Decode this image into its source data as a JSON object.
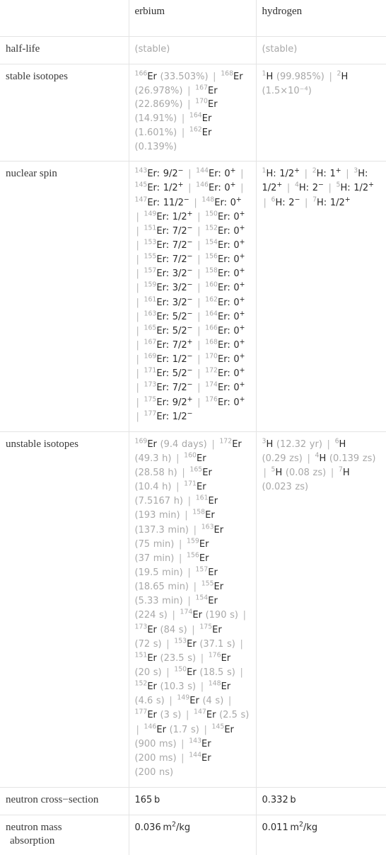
{
  "table": {
    "columns": [
      "",
      "erbium",
      "hydrogen"
    ],
    "rows": [
      {
        "label": "half-life",
        "erbium": "(stable)",
        "hydrogen": "(stable)"
      },
      {
        "label": "stable isotopes",
        "erbium": "166Er (33.503%) | 168Er (26.978%) | 167Er (22.869%) | 170Er (14.91%) | 164Er (1.601%) | 162Er (0.139%)",
        "hydrogen": "1H (99.985%) | 2H (1.5×10^-4)"
      },
      {
        "label": "nuclear spin",
        "erbium": "143Er: 9/2- | 144Er: 0+ | 145Er: 1/2+ | 146Er: 0+ | 147Er: 11/2- | 148Er: 0+ | 149Er: 1/2+ | 150Er: 0+ | 151Er: 7/2- | 152Er: 0+ | 153Er: 7/2- | 154Er: 0+ | 155Er: 7/2- | 156Er: 0+ | 157Er: 3/2- | 158Er: 0+ | 159Er: 3/2- | 160Er: 0+ | 161Er: 3/2- | 162Er: 0+ | 163Er: 5/2- | 164Er: 0+ | 165Er: 5/2- | 166Er: 0+ | 167Er: 7/2+ | 168Er: 0+ | 169Er: 1/2- | 170Er: 0+ | 171Er: 5/2- | 172Er: 0+ | 173Er: 7/2- | 174Er: 0+ | 175Er: 9/2+ | 176Er: 0+ | 177Er: 1/2-",
        "hydrogen": "1H: 1/2+ | 2H: 1+ | 3H: 1/2+ | 4H: 2- | 5H: 1/2+ | 6H: 2- | 7H: 1/2+"
      },
      {
        "label": "unstable isotopes",
        "erbium": "169Er (9.4 days) | 172Er (49.3 h) | 160Er (28.58 h) | 165Er (10.4 h) | 171Er (7.5167 h) | 161Er (193 min) | 158Er (137.3 min) | 163Er (75 min) | 159Er (37 min) | 156Er (19.5 min) | 157Er (18.65 min) | 155Er (5.33 min) | 154Er (224 s) | 174Er (190 s) | 173Er (84 s) | 175Er (72 s) | 153Er (37.1 s) | 151Er (23.5 s) | 176Er (20 s) | 150Er (18.5 s) | 152Er (10.3 s) | 148Er (4.6 s) | 149Er (4 s) | 177Er (3 s) | 147Er (2.5 s) | 146Er (1.7 s) | 145Er (900 ms) | 143Er (200 ms) | 144Er (200 ns)",
        "hydrogen": "3H (12.32 yr) | 6H (0.29 zs) | 4H (0.139 zs) | 5H (0.08 zs) | 7H (0.023 zs)"
      },
      {
        "label": "neutron cross-section",
        "erbium": "165 b",
        "hydrogen": "0.332 b"
      },
      {
        "label": "neutron mass absorption",
        "label_line1": "neutron mass",
        "label_line2": "absorption",
        "erbium": "0.036 m2/kg",
        "hydrogen": "0.011 m2/kg"
      }
    ]
  },
  "stable_isotopes": {
    "erbium": [
      {
        "mass": "166",
        "sym": "Er",
        "abundance": "(33.503%)"
      },
      {
        "mass": "168",
        "sym": "Er",
        "abundance": "(26.978%)"
      },
      {
        "mass": "167",
        "sym": "Er",
        "abundance": "(22.869%)"
      },
      {
        "mass": "170",
        "sym": "Er",
        "abundance": "(14.91%)"
      },
      {
        "mass": "164",
        "sym": "Er",
        "abundance": "(1.601%)"
      },
      {
        "mass": "162",
        "sym": "Er",
        "abundance": "(0.139%)"
      }
    ],
    "hydrogen": [
      {
        "mass": "1",
        "sym": "H",
        "abundance": "(99.985%)"
      },
      {
        "mass": "2",
        "sym": "H",
        "abundance": "(1.5×10⁻⁴)"
      }
    ]
  },
  "nuclear_spin": {
    "erbium": [
      {
        "mass": "143",
        "sym": "Er",
        "spin": "9/2",
        "sign": "−"
      },
      {
        "mass": "144",
        "sym": "Er",
        "spin": "0",
        "sign": "+"
      },
      {
        "mass": "145",
        "sym": "Er",
        "spin": "1/2",
        "sign": "+"
      },
      {
        "mass": "146",
        "sym": "Er",
        "spin": "0",
        "sign": "+"
      },
      {
        "mass": "147",
        "sym": "Er",
        "spin": "11/2",
        "sign": "−"
      },
      {
        "mass": "148",
        "sym": "Er",
        "spin": "0",
        "sign": "+"
      },
      {
        "mass": "149",
        "sym": "Er",
        "spin": "1/2",
        "sign": "+"
      },
      {
        "mass": "150",
        "sym": "Er",
        "spin": "0",
        "sign": "+"
      },
      {
        "mass": "151",
        "sym": "Er",
        "spin": "7/2",
        "sign": "−"
      },
      {
        "mass": "152",
        "sym": "Er",
        "spin": "0",
        "sign": "+"
      },
      {
        "mass": "153",
        "sym": "Er",
        "spin": "7/2",
        "sign": "−"
      },
      {
        "mass": "154",
        "sym": "Er",
        "spin": "0",
        "sign": "+"
      },
      {
        "mass": "155",
        "sym": "Er",
        "spin": "7/2",
        "sign": "−"
      },
      {
        "mass": "156",
        "sym": "Er",
        "spin": "0",
        "sign": "+"
      },
      {
        "mass": "157",
        "sym": "Er",
        "spin": "3/2",
        "sign": "−"
      },
      {
        "mass": "158",
        "sym": "Er",
        "spin": "0",
        "sign": "+"
      },
      {
        "mass": "159",
        "sym": "Er",
        "spin": "3/2",
        "sign": "−"
      },
      {
        "mass": "160",
        "sym": "Er",
        "spin": "0",
        "sign": "+"
      },
      {
        "mass": "161",
        "sym": "Er",
        "spin": "3/2",
        "sign": "−"
      },
      {
        "mass": "162",
        "sym": "Er",
        "spin": "0",
        "sign": "+"
      },
      {
        "mass": "163",
        "sym": "Er",
        "spin": "5/2",
        "sign": "−"
      },
      {
        "mass": "164",
        "sym": "Er",
        "spin": "0",
        "sign": "+"
      },
      {
        "mass": "165",
        "sym": "Er",
        "spin": "5/2",
        "sign": "−"
      },
      {
        "mass": "166",
        "sym": "Er",
        "spin": "0",
        "sign": "+"
      },
      {
        "mass": "167",
        "sym": "Er",
        "spin": "7/2",
        "sign": "+"
      },
      {
        "mass": "168",
        "sym": "Er",
        "spin": "0",
        "sign": "+"
      },
      {
        "mass": "169",
        "sym": "Er",
        "spin": "1/2",
        "sign": "−"
      },
      {
        "mass": "170",
        "sym": "Er",
        "spin": "0",
        "sign": "+"
      },
      {
        "mass": "171",
        "sym": "Er",
        "spin": "5/2",
        "sign": "−"
      },
      {
        "mass": "172",
        "sym": "Er",
        "spin": "0",
        "sign": "+"
      },
      {
        "mass": "173",
        "sym": "Er",
        "spin": "7/2",
        "sign": "−"
      },
      {
        "mass": "174",
        "sym": "Er",
        "spin": "0",
        "sign": "+"
      },
      {
        "mass": "175",
        "sym": "Er",
        "spin": "9/2",
        "sign": "+"
      },
      {
        "mass": "176",
        "sym": "Er",
        "spin": "0",
        "sign": "+"
      },
      {
        "mass": "177",
        "sym": "Er",
        "spin": "1/2",
        "sign": "−"
      }
    ],
    "hydrogen": [
      {
        "mass": "1",
        "sym": "H",
        "spin": "1/2",
        "sign": "+"
      },
      {
        "mass": "2",
        "sym": "H",
        "spin": "1",
        "sign": "+"
      },
      {
        "mass": "3",
        "sym": "H",
        "spin": "1/2",
        "sign": "+"
      },
      {
        "mass": "4",
        "sym": "H",
        "spin": "2",
        "sign": "−"
      },
      {
        "mass": "5",
        "sym": "H",
        "spin": "1/2",
        "sign": "+"
      },
      {
        "mass": "6",
        "sym": "H",
        "spin": "2",
        "sign": "−"
      },
      {
        "mass": "7",
        "sym": "H",
        "spin": "1/2",
        "sign": "+"
      }
    ]
  },
  "unstable_isotopes": {
    "erbium": [
      {
        "mass": "169",
        "sym": "Er",
        "halflife": "(9.4 days)"
      },
      {
        "mass": "172",
        "sym": "Er",
        "halflife": "(49.3 h)"
      },
      {
        "mass": "160",
        "sym": "Er",
        "halflife": "(28.58 h)"
      },
      {
        "mass": "165",
        "sym": "Er",
        "halflife": "(10.4 h)"
      },
      {
        "mass": "171",
        "sym": "Er",
        "halflife": "(7.5167 h)"
      },
      {
        "mass": "161",
        "sym": "Er",
        "halflife": "(193 min)"
      },
      {
        "mass": "158",
        "sym": "Er",
        "halflife": "(137.3 min)"
      },
      {
        "mass": "163",
        "sym": "Er",
        "halflife": "(75 min)"
      },
      {
        "mass": "159",
        "sym": "Er",
        "halflife": "(37 min)"
      },
      {
        "mass": "156",
        "sym": "Er",
        "halflife": "(19.5 min)"
      },
      {
        "mass": "157",
        "sym": "Er",
        "halflife": "(18.65 min)"
      },
      {
        "mass": "155",
        "sym": "Er",
        "halflife": "(5.33 min)"
      },
      {
        "mass": "154",
        "sym": "Er",
        "halflife": "(224 s)"
      },
      {
        "mass": "174",
        "sym": "Er",
        "halflife": "(190 s)"
      },
      {
        "mass": "173",
        "sym": "Er",
        "halflife": "(84 s)"
      },
      {
        "mass": "175",
        "sym": "Er",
        "halflife": "(72 s)"
      },
      {
        "mass": "153",
        "sym": "Er",
        "halflife": "(37.1 s)"
      },
      {
        "mass": "151",
        "sym": "Er",
        "halflife": "(23.5 s)"
      },
      {
        "mass": "176",
        "sym": "Er",
        "halflife": "(20 s)"
      },
      {
        "mass": "150",
        "sym": "Er",
        "halflife": "(18.5 s)"
      },
      {
        "mass": "152",
        "sym": "Er",
        "halflife": "(10.3 s)"
      },
      {
        "mass": "148",
        "sym": "Er",
        "halflife": "(4.6 s)"
      },
      {
        "mass": "149",
        "sym": "Er",
        "halflife": "(4 s)"
      },
      {
        "mass": "177",
        "sym": "Er",
        "halflife": "(3 s)"
      },
      {
        "mass": "147",
        "sym": "Er",
        "halflife": "(2.5 s)"
      },
      {
        "mass": "146",
        "sym": "Er",
        "halflife": "(1.7 s)"
      },
      {
        "mass": "145",
        "sym": "Er",
        "halflife": "(900 ms)"
      },
      {
        "mass": "143",
        "sym": "Er",
        "halflife": "(200 ms)"
      },
      {
        "mass": "144",
        "sym": "Er",
        "halflife": "(200 ns)"
      }
    ],
    "hydrogen": [
      {
        "mass": "3",
        "sym": "H",
        "halflife": "(12.32 yr)"
      },
      {
        "mass": "6",
        "sym": "H",
        "halflife": "(0.29 zs)"
      },
      {
        "mass": "4",
        "sym": "H",
        "halflife": "(0.139 zs)"
      },
      {
        "mass": "5",
        "sym": "H",
        "halflife": "(0.08 zs)"
      },
      {
        "mass": "7",
        "sym": "H",
        "halflife": "(0.023 zs)"
      }
    ]
  },
  "labels": {
    "half_life": "half-life",
    "stable_isotopes": "stable isotopes",
    "nuclear_spin": "nuclear spin",
    "unstable_isotopes": "unstable isotopes",
    "neutron_cross_section": "neutron cross−section",
    "neutron_mass_absorption_l1": "neutron mass",
    "neutron_mass_absorption_l2": "absorption"
  },
  "header": {
    "col1": "erbium",
    "col2": "hydrogen"
  },
  "halflife": {
    "erbium": "(stable)",
    "hydrogen": "(stable)"
  },
  "neutron_cross_section": {
    "erbium_value": "165",
    "erbium_unit": "b",
    "hydrogen_value": "0.332",
    "hydrogen_unit": "b"
  },
  "neutron_mass_absorption": {
    "erbium_value": "0.036",
    "erbium_unit_base": "m",
    "erbium_unit_exp": "2",
    "erbium_unit_denom": "/kg",
    "hydrogen_value": "0.011",
    "hydrogen_unit_base": "m",
    "hydrogen_unit_exp": "2",
    "hydrogen_unit_denom": "/kg"
  },
  "colors": {
    "border": "#e4e4e4",
    "text": "#2a2a2a",
    "dim_text": "#a8a8a8",
    "label_text": "#3a3a3a"
  },
  "separator": "|"
}
